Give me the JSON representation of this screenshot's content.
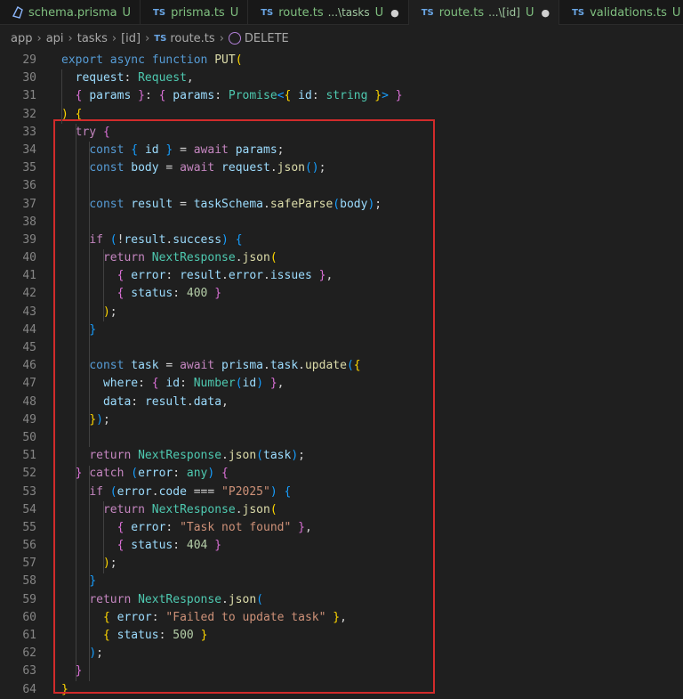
{
  "tabs": [
    {
      "label": "schema.prisma",
      "status": "U",
      "icon": "prisma-icon"
    },
    {
      "label": "prisma.ts",
      "status": "U",
      "icon": "ts-icon"
    },
    {
      "label": "route.ts",
      "path": "...\\tasks",
      "status": "U",
      "modified": "●",
      "icon": "ts-icon"
    },
    {
      "label": "route.ts",
      "path": "...\\[id]",
      "status": "U",
      "modified": "●",
      "icon": "ts-icon"
    },
    {
      "label": "validations.ts",
      "status": "U",
      "icon": "ts-icon"
    }
  ],
  "ts_badge": "TS",
  "breadcrumb": [
    "app",
    "api",
    "tasks",
    "[id]",
    "route.ts",
    "DELETE"
  ],
  "lines": [
    {
      "n": "29"
    },
    {
      "n": "30"
    },
    {
      "n": "31"
    },
    {
      "n": "32"
    },
    {
      "n": "33"
    },
    {
      "n": "34"
    },
    {
      "n": "35"
    },
    {
      "n": "36"
    },
    {
      "n": "37"
    },
    {
      "n": "38"
    },
    {
      "n": "39"
    },
    {
      "n": "40"
    },
    {
      "n": "41"
    },
    {
      "n": "42"
    },
    {
      "n": "43"
    },
    {
      "n": "44"
    },
    {
      "n": "45"
    },
    {
      "n": "46"
    },
    {
      "n": "47"
    },
    {
      "n": "48"
    },
    {
      "n": "49"
    },
    {
      "n": "50"
    },
    {
      "n": "51"
    },
    {
      "n": "52"
    },
    {
      "n": "53"
    },
    {
      "n": "54"
    },
    {
      "n": "55"
    },
    {
      "n": "56"
    },
    {
      "n": "57"
    },
    {
      "n": "58"
    },
    {
      "n": "59"
    },
    {
      "n": "60"
    },
    {
      "n": "61"
    },
    {
      "n": "62"
    },
    {
      "n": "63"
    },
    {
      "n": "64"
    }
  ],
  "code": [
    [
      [
        "k",
        "export "
      ],
      [
        "k",
        "async "
      ],
      [
        "k",
        "function "
      ],
      [
        "f",
        "PUT"
      ],
      [
        "b1",
        "("
      ]
    ],
    [
      [
        "p",
        "  "
      ],
      [
        "v",
        "request"
      ],
      [
        "p",
        ": "
      ],
      [
        "t",
        "Request"
      ],
      [
        "p",
        ","
      ]
    ],
    [
      [
        "p",
        "  "
      ],
      [
        "b2",
        "{ "
      ],
      [
        "v",
        "params "
      ],
      [
        "b2",
        "}"
      ],
      [
        "p",
        ": "
      ],
      [
        "b2",
        "{ "
      ],
      [
        "v",
        "params"
      ],
      [
        "p",
        ": "
      ],
      [
        "t",
        "Promise"
      ],
      [
        "b3",
        "<"
      ],
      [
        "b1",
        "{ "
      ],
      [
        "v",
        "id"
      ],
      [
        "p",
        ": "
      ],
      [
        "t",
        "string "
      ],
      [
        "b1",
        "}"
      ],
      [
        "b3",
        "> "
      ],
      [
        "b2",
        "}"
      ]
    ],
    [
      [
        "b1",
        ") "
      ],
      [
        "b1",
        "{"
      ]
    ],
    [
      [
        "p",
        "  "
      ],
      [
        "kc",
        "try "
      ],
      [
        "b2",
        "{"
      ]
    ],
    [
      [
        "p",
        "    "
      ],
      [
        "k",
        "const "
      ],
      [
        "b3",
        "{ "
      ],
      [
        "v",
        "id "
      ],
      [
        "b3",
        "} "
      ],
      [
        "p",
        "= "
      ],
      [
        "kc",
        "await "
      ],
      [
        "v",
        "params"
      ],
      [
        "p",
        ";"
      ]
    ],
    [
      [
        "p",
        "    "
      ],
      [
        "k",
        "const "
      ],
      [
        "v",
        "body "
      ],
      [
        "p",
        "= "
      ],
      [
        "kc",
        "await "
      ],
      [
        "v",
        "request"
      ],
      [
        "p",
        "."
      ],
      [
        "f",
        "json"
      ],
      [
        "b3",
        "()"
      ],
      [
        "p",
        ";"
      ]
    ],
    [],
    [
      [
        "p",
        "    "
      ],
      [
        "k",
        "const "
      ],
      [
        "v",
        "result "
      ],
      [
        "p",
        "= "
      ],
      [
        "v",
        "taskSchema"
      ],
      [
        "p",
        "."
      ],
      [
        "f",
        "safeParse"
      ],
      [
        "b3",
        "("
      ],
      [
        "v",
        "body"
      ],
      [
        "b3",
        ")"
      ],
      [
        "p",
        ";"
      ]
    ],
    [],
    [
      [
        "p",
        "    "
      ],
      [
        "kc",
        "if "
      ],
      [
        "b3",
        "("
      ],
      [
        "p",
        "!"
      ],
      [
        "v",
        "result"
      ],
      [
        "p",
        "."
      ],
      [
        "v",
        "success"
      ],
      [
        "b3",
        ") "
      ],
      [
        "b3",
        "{"
      ]
    ],
    [
      [
        "p",
        "      "
      ],
      [
        "kc",
        "return "
      ],
      [
        "t",
        "NextResponse"
      ],
      [
        "p",
        "."
      ],
      [
        "f",
        "json"
      ],
      [
        "b1",
        "("
      ]
    ],
    [
      [
        "p",
        "        "
      ],
      [
        "b2",
        "{ "
      ],
      [
        "v",
        "error"
      ],
      [
        "p",
        ": "
      ],
      [
        "v",
        "result"
      ],
      [
        "p",
        "."
      ],
      [
        "v",
        "error"
      ],
      [
        "p",
        "."
      ],
      [
        "v",
        "issues "
      ],
      [
        "b2",
        "}"
      ],
      [
        "p",
        ","
      ]
    ],
    [
      [
        "p",
        "        "
      ],
      [
        "b2",
        "{ "
      ],
      [
        "v",
        "status"
      ],
      [
        "p",
        ": "
      ],
      [
        "n",
        "400 "
      ],
      [
        "b2",
        "}"
      ]
    ],
    [
      [
        "p",
        "      "
      ],
      [
        "b1",
        ")"
      ],
      [
        "p",
        ";"
      ]
    ],
    [
      [
        "p",
        "    "
      ],
      [
        "b3",
        "}"
      ]
    ],
    [],
    [
      [
        "p",
        "    "
      ],
      [
        "k",
        "const "
      ],
      [
        "v",
        "task "
      ],
      [
        "p",
        "= "
      ],
      [
        "kc",
        "await "
      ],
      [
        "v",
        "prisma"
      ],
      [
        "p",
        "."
      ],
      [
        "v",
        "task"
      ],
      [
        "p",
        "."
      ],
      [
        "f",
        "update"
      ],
      [
        "b3",
        "("
      ],
      [
        "b1",
        "{"
      ]
    ],
    [
      [
        "p",
        "      "
      ],
      [
        "v",
        "where"
      ],
      [
        "p",
        ": "
      ],
      [
        "b2",
        "{ "
      ],
      [
        "v",
        "id"
      ],
      [
        "p",
        ": "
      ],
      [
        "t",
        "Number"
      ],
      [
        "b3",
        "("
      ],
      [
        "v",
        "id"
      ],
      [
        "b3",
        ") "
      ],
      [
        "b2",
        "}"
      ],
      [
        "p",
        ","
      ]
    ],
    [
      [
        "p",
        "      "
      ],
      [
        "v",
        "data"
      ],
      [
        "p",
        ": "
      ],
      [
        "v",
        "result"
      ],
      [
        "p",
        "."
      ],
      [
        "v",
        "data"
      ],
      [
        "p",
        ","
      ]
    ],
    [
      [
        "p",
        "    "
      ],
      [
        "b1",
        "}"
      ],
      [
        "b3",
        ")"
      ],
      [
        "p",
        ";"
      ]
    ],
    [],
    [
      [
        "p",
        "    "
      ],
      [
        "kc",
        "return "
      ],
      [
        "t",
        "NextResponse"
      ],
      [
        "p",
        "."
      ],
      [
        "f",
        "json"
      ],
      [
        "b3",
        "("
      ],
      [
        "v",
        "task"
      ],
      [
        "b3",
        ")"
      ],
      [
        "p",
        ";"
      ]
    ],
    [
      [
        "p",
        "  "
      ],
      [
        "b2",
        "} "
      ],
      [
        "kc",
        "catch "
      ],
      [
        "b3",
        "("
      ],
      [
        "v",
        "error"
      ],
      [
        "p",
        ": "
      ],
      [
        "t",
        "any"
      ],
      [
        "b3",
        ") "
      ],
      [
        "b2",
        "{"
      ]
    ],
    [
      [
        "p",
        "    "
      ],
      [
        "kc",
        "if "
      ],
      [
        "b3",
        "("
      ],
      [
        "v",
        "error"
      ],
      [
        "p",
        "."
      ],
      [
        "v",
        "code "
      ],
      [
        "p",
        "=== "
      ],
      [
        "s",
        "\"P2025\""
      ],
      [
        "b3",
        ") "
      ],
      [
        "b3",
        "{"
      ]
    ],
    [
      [
        "p",
        "      "
      ],
      [
        "kc",
        "return "
      ],
      [
        "t",
        "NextResponse"
      ],
      [
        "p",
        "."
      ],
      [
        "f",
        "json"
      ],
      [
        "b1",
        "("
      ]
    ],
    [
      [
        "p",
        "        "
      ],
      [
        "b2",
        "{ "
      ],
      [
        "v",
        "error"
      ],
      [
        "p",
        ": "
      ],
      [
        "s",
        "\"Task not found\" "
      ],
      [
        "b2",
        "}"
      ],
      [
        "p",
        ","
      ]
    ],
    [
      [
        "p",
        "        "
      ],
      [
        "b2",
        "{ "
      ],
      [
        "v",
        "status"
      ],
      [
        "p",
        ": "
      ],
      [
        "n",
        "404 "
      ],
      [
        "b2",
        "}"
      ]
    ],
    [
      [
        "p",
        "      "
      ],
      [
        "b1",
        ")"
      ],
      [
        "p",
        ";"
      ]
    ],
    [
      [
        "p",
        "    "
      ],
      [
        "b3",
        "}"
      ]
    ],
    [
      [
        "p",
        "    "
      ],
      [
        "kc",
        "return "
      ],
      [
        "t",
        "NextResponse"
      ],
      [
        "p",
        "."
      ],
      [
        "f",
        "json"
      ],
      [
        "b3",
        "("
      ]
    ],
    [
      [
        "p",
        "      "
      ],
      [
        "b1",
        "{ "
      ],
      [
        "v",
        "error"
      ],
      [
        "p",
        ": "
      ],
      [
        "s",
        "\"Failed to update task\" "
      ],
      [
        "b1",
        "}"
      ],
      [
        "p",
        ","
      ]
    ],
    [
      [
        "p",
        "      "
      ],
      [
        "b1",
        "{ "
      ],
      [
        "v",
        "status"
      ],
      [
        "p",
        ": "
      ],
      [
        "n",
        "500 "
      ],
      [
        "b1",
        "}"
      ]
    ],
    [
      [
        "p",
        "    "
      ],
      [
        "b3",
        ")"
      ],
      [
        "p",
        ";"
      ]
    ],
    [
      [
        "p",
        "  "
      ],
      [
        "b2",
        "}"
      ]
    ],
    [
      [
        "b1",
        "}"
      ]
    ]
  ]
}
